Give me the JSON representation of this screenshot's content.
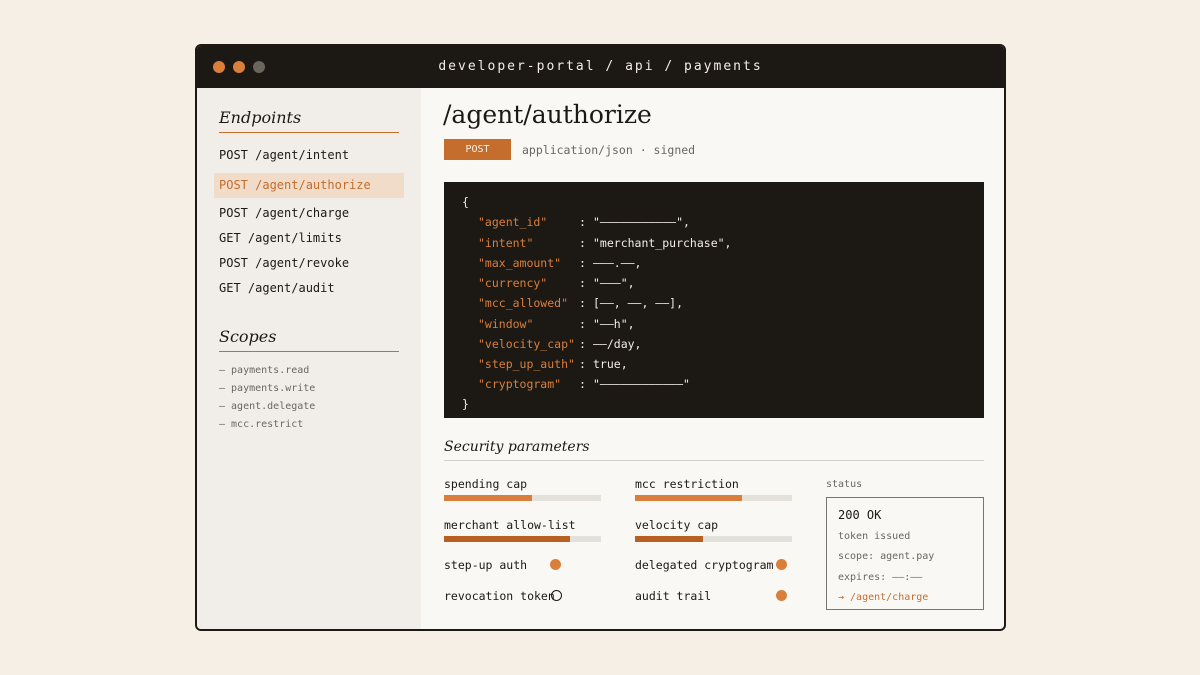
{
  "window": {
    "title": "developer-portal / api / payments"
  },
  "sidebar": {
    "endpoints_heading": "Endpoints",
    "endpoints": [
      {
        "label": "POST /agent/intent",
        "active": false
      },
      {
        "label": "POST /agent/authorize",
        "active": true
      },
      {
        "label": "POST /agent/charge",
        "active": false
      },
      {
        "label": "GET /agent/limits",
        "active": false
      },
      {
        "label": "POST /agent/revoke",
        "active": false
      },
      {
        "label": "GET /agent/audit",
        "active": false
      }
    ],
    "scopes_heading": "Scopes",
    "scopes": [
      "— payments.read",
      "— payments.write",
      "— agent.delegate",
      "— mcc.restrict"
    ]
  },
  "endpoint": {
    "path": "/agent/authorize",
    "method": "POST",
    "meta": "application/json · signed"
  },
  "code": {
    "open": "{",
    "close": "}",
    "lines": [
      {
        "key": "\"agent_id\"",
        "value": "\"———————————\","
      },
      {
        "key": "\"intent\"",
        "value": "\"merchant_purchase\","
      },
      {
        "key": "\"max_amount\"",
        "value": "———.——,"
      },
      {
        "key": "\"currency\"",
        "value": "\"———\","
      },
      {
        "key": "\"mcc_allowed\"",
        "value": "[——, ——, ——],"
      },
      {
        "key": "\"window\"",
        "value": "\"——h\","
      },
      {
        "key": "\"velocity_cap\"",
        "value": "——/day,"
      },
      {
        "key": "\"step_up_auth\"",
        "value": "true,"
      },
      {
        "key": "\"cryptogram\"",
        "value": "\"————————————\""
      }
    ]
  },
  "security": {
    "heading": "Security parameters",
    "bars": [
      {
        "label": "spending cap",
        "level": 0.56
      },
      {
        "label": "mcc restriction",
        "level": 0.68
      },
      {
        "label": "merchant allow-list",
        "level": 0.8
      },
      {
        "label": "velocity cap",
        "level": 0.43
      }
    ],
    "toggles": [
      {
        "label": "step-up auth",
        "on": true
      },
      {
        "label": "delegated cryptogram",
        "on": true
      },
      {
        "label": "revocation token",
        "on": false
      },
      {
        "label": "audit trail",
        "on": true
      }
    ]
  },
  "status": {
    "label": "status",
    "code": "200 OK",
    "message": "token issued",
    "scope": "scope: agent.pay",
    "expires": "expires: ——:——",
    "next": "→ /agent/charge"
  },
  "colors": {
    "accent": "#d97f3b",
    "accent_dark": "#c46d2d",
    "ink": "#1c1915",
    "active_bg": "#f0dcc8"
  }
}
